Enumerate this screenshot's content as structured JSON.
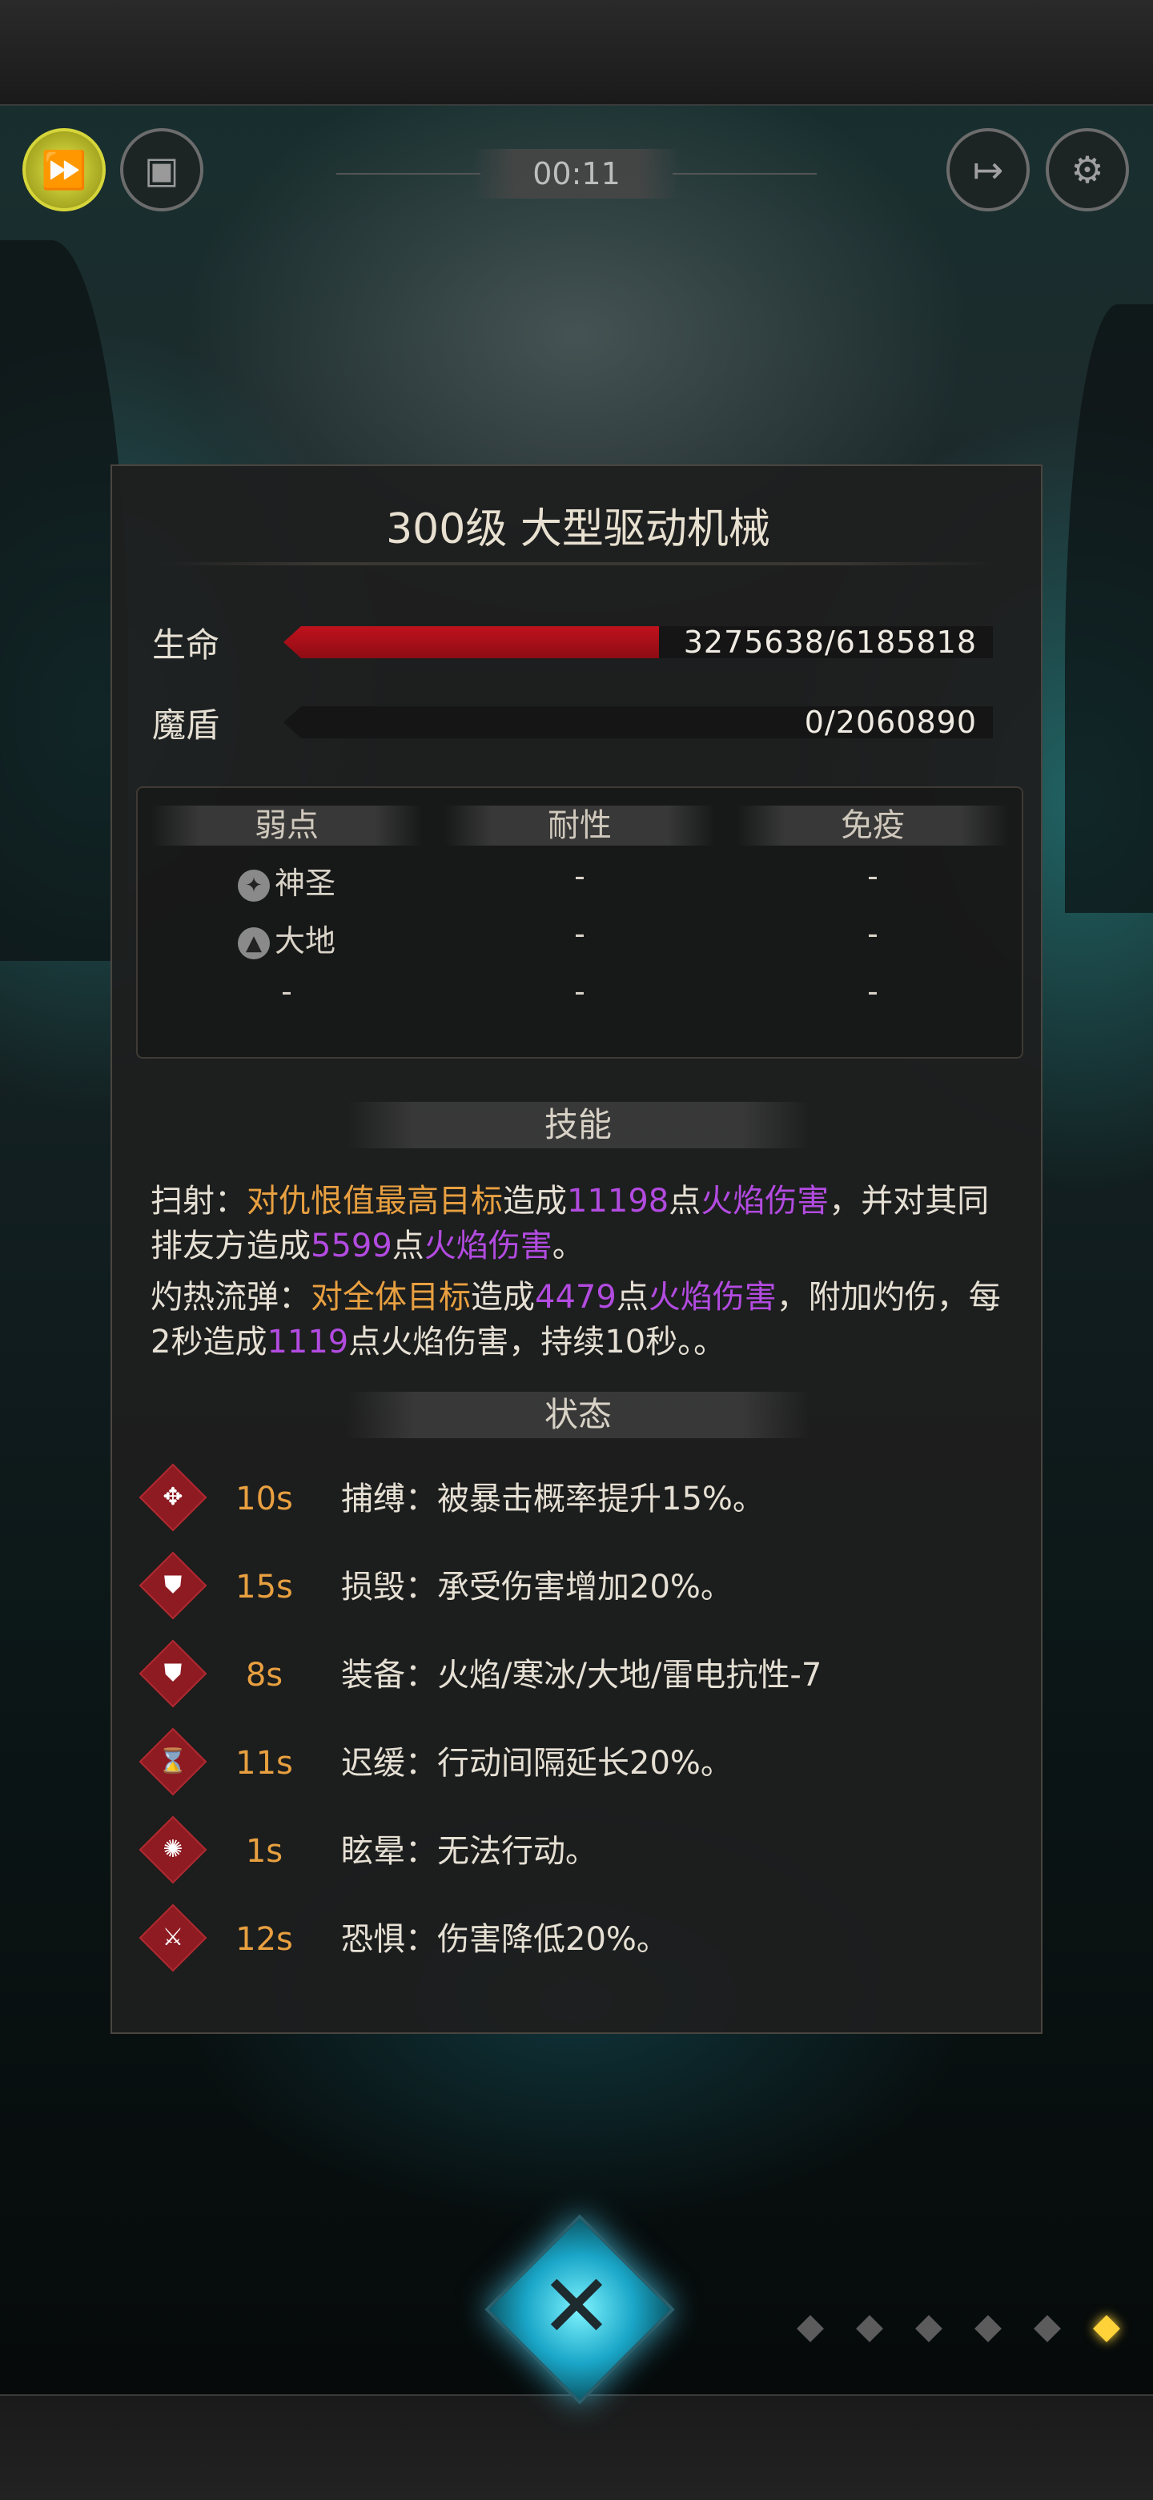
{
  "hud": {
    "timer": "00:11",
    "icons": [
      "fast-forward-icon",
      "auto-battle-icon",
      "exit-icon",
      "settings-icon"
    ]
  },
  "enemy": {
    "title": "300级  大型驱动机械",
    "hp_label": "生命",
    "hp_text": "3275638/6185818",
    "hp_fraction": 0.5296,
    "shield_label": "魔盾",
    "shield_text": "0/2060890",
    "shield_fraction": 0
  },
  "resistances": {
    "headers": [
      "弱点",
      "耐性",
      "免疫"
    ],
    "rows": [
      {
        "weak_icon": "holy-icon",
        "weak": "神圣",
        "resist": "-",
        "immune": "-"
      },
      {
        "weak_icon": "earth-icon",
        "weak": "大地",
        "resist": "-",
        "immune": "-"
      },
      {
        "weak_icon": "",
        "weak": "-",
        "resist": "-",
        "immune": "-"
      }
    ]
  },
  "skills": {
    "header": "技能",
    "s1": {
      "name": "扫射：",
      "t1": "对仇恨值最高目标",
      "t2": "造成",
      "v1": "11198",
      "t3": "点",
      "dmg1": "火焰伤害",
      "t4": "，并对其同排友方造成",
      "v2": "5599",
      "t5": "点",
      "dmg2": "火焰伤害",
      "t6": "。"
    },
    "s2": {
      "name": "灼热流弹：",
      "t1": "对全体目标",
      "t2": "造成",
      "v1": "4479",
      "t3": "点",
      "dmg1": "火焰伤害",
      "t4": "，附加灼伤，每2秒造成",
      "v2": "1119",
      "t5": "点火焰伤害，持续10秒。。"
    }
  },
  "status": {
    "header": "状态",
    "items": [
      {
        "icon": "capture-icon",
        "time": "10s",
        "text": "捕缚：被暴击概率提升15%。"
      },
      {
        "icon": "shield-break-icon",
        "time": "15s",
        "text": "损毁：承受伤害增加20%。"
      },
      {
        "icon": "equip-shield-icon",
        "time": "8s",
        "text": "装备：火焰/寒冰/大地/雷电抗性-7"
      },
      {
        "icon": "hourglass-icon",
        "time": "11s",
        "text": "迟缓：行动间隔延长20%。"
      },
      {
        "icon": "stun-icon",
        "time": "1s",
        "text": "眩晕：无法行动。"
      },
      {
        "icon": "fear-icon",
        "time": "12s",
        "text": "恐惧：伤害降低20%。"
      }
    ]
  },
  "colors": {
    "orange": "#e8a040",
    "purple": "#b24be0",
    "hp_red": "#c0121d",
    "debuff_red": "#8e1b22",
    "active_dot": "#ffd23a"
  },
  "pagination": {
    "total": 6,
    "active_index": 5
  }
}
